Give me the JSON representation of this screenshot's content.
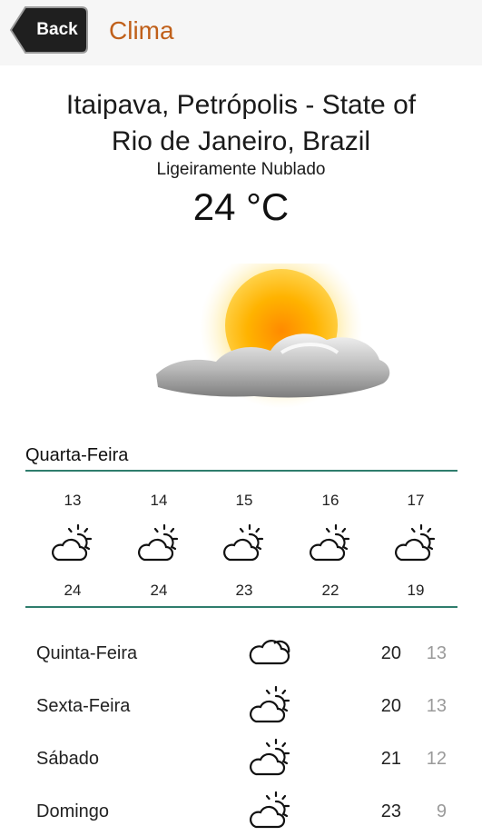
{
  "header": {
    "back_label": "Back",
    "title": "Clima"
  },
  "current": {
    "location_line1": "Itaipava, Petrópolis - State of",
    "location_line2": "Rio de Janeiro, Brazil",
    "condition": "Ligeiramente Nublado",
    "temperature": "24 °C",
    "icon": "partly-cloudy-sun-icon"
  },
  "today": {
    "label": "Quarta-Feira",
    "hours": [
      {
        "hour": "13",
        "temp": "24",
        "icon": "partly-cloudy-icon"
      },
      {
        "hour": "14",
        "temp": "24",
        "icon": "partly-cloudy-icon"
      },
      {
        "hour": "15",
        "temp": "23",
        "icon": "partly-cloudy-icon"
      },
      {
        "hour": "16",
        "temp": "22",
        "icon": "partly-cloudy-icon"
      },
      {
        "hour": "17",
        "temp": "19",
        "icon": "partly-cloudy-icon"
      }
    ]
  },
  "forecast": [
    {
      "day": "Quinta-Feira",
      "max": "20",
      "min": "13",
      "icon": "cloud-icon"
    },
    {
      "day": "Sexta-Feira",
      "max": "20",
      "min": "13",
      "icon": "partly-cloudy-icon"
    },
    {
      "day": "Sábado",
      "max": "21",
      "min": "12",
      "icon": "partly-cloudy-icon"
    },
    {
      "day": "Domingo",
      "max": "23",
      "min": "9",
      "icon": "partly-cloudy-icon"
    }
  ],
  "colors": {
    "accent": "#c0601a",
    "divider": "#2f7d6d",
    "min_temp": "#9a9a9a",
    "back_button": "#1f1f1f"
  }
}
